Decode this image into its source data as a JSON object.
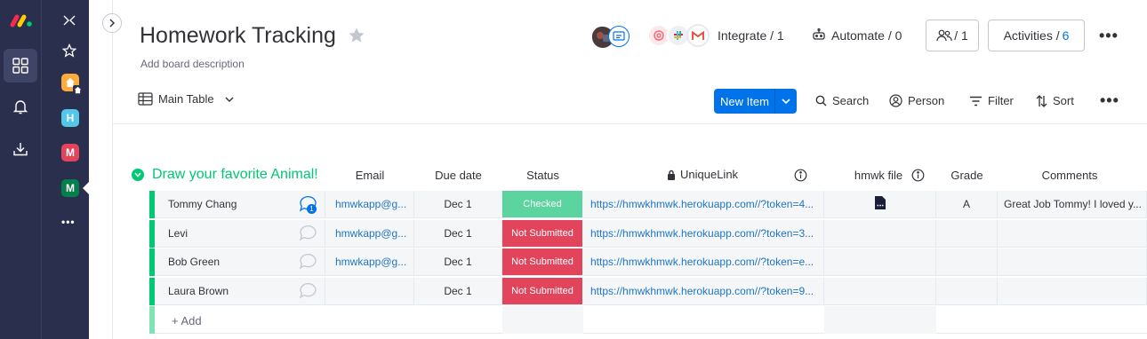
{
  "rail": {
    "icons": [
      "monday-logo",
      "apps-grid-icon",
      "bell-icon",
      "download-icon"
    ]
  },
  "workspaces": {
    "items": [
      {
        "letter": "H",
        "color": "#4eccc6",
        "label_bg": "#54c6e7"
      },
      {
        "letter": "M",
        "color": "#e2445c"
      },
      {
        "letter": "M",
        "color": "#037f4c"
      }
    ],
    "more": "•••"
  },
  "board": {
    "title": "Homework Tracking",
    "description": "Add board description",
    "integrate": "Integrate / 1",
    "automate": "Automate / 0",
    "members_count": "/ 1",
    "activities_label": "Activities /",
    "activities_count": "6",
    "more": "•••"
  },
  "toolbar": {
    "view": "Main Table",
    "new_item": "New Item",
    "search": "Search",
    "person": "Person",
    "filter": "Filter",
    "sort": "Sort",
    "more": "•••"
  },
  "group": {
    "title": "Draw your favorite Animal!",
    "color": "#00c875",
    "columns": {
      "email": "Email",
      "due": "Due date",
      "status": "Status",
      "link": "UniqueLink",
      "file": "hmwk file",
      "grade": "Grade",
      "comments": "Comments"
    },
    "rows": [
      {
        "name": "Tommy Chang",
        "updates": "1",
        "email": "hmwkapp@g...",
        "due": "Dec 1",
        "status": "Checked",
        "status_color": "#5cd4a0",
        "link": "https://hmwkhmwk.herokuapp.com//?token=4...",
        "has_file": true,
        "grade": "A",
        "comment": "Great Job Tommy! I loved y..."
      },
      {
        "name": "Levi",
        "updates": "",
        "email": "hmwkapp@g...",
        "due": "Dec 1",
        "status": "Not Submitted",
        "status_color": "#e2445c",
        "link": "https://hmwkhmwk.herokuapp.com//?token=3...",
        "has_file": false,
        "grade": "",
        "comment": ""
      },
      {
        "name": "Bob Green",
        "updates": "",
        "email": "hmwkapp@g...",
        "due": "Dec 1",
        "status": "Not Submitted",
        "status_color": "#e2445c",
        "link": "https://hmwkhmwk.herokuapp.com//?token=e...",
        "has_file": false,
        "grade": "",
        "comment": ""
      },
      {
        "name": "Laura Brown",
        "updates": "",
        "email": "",
        "due": "Dec 1",
        "status": "Not Submitted",
        "status_color": "#e2445c",
        "link": "https://hmwkhmwk.herokuapp.com//?token=9...",
        "has_file": false,
        "grade": "",
        "comment": ""
      }
    ],
    "add_label": "+ Add"
  }
}
